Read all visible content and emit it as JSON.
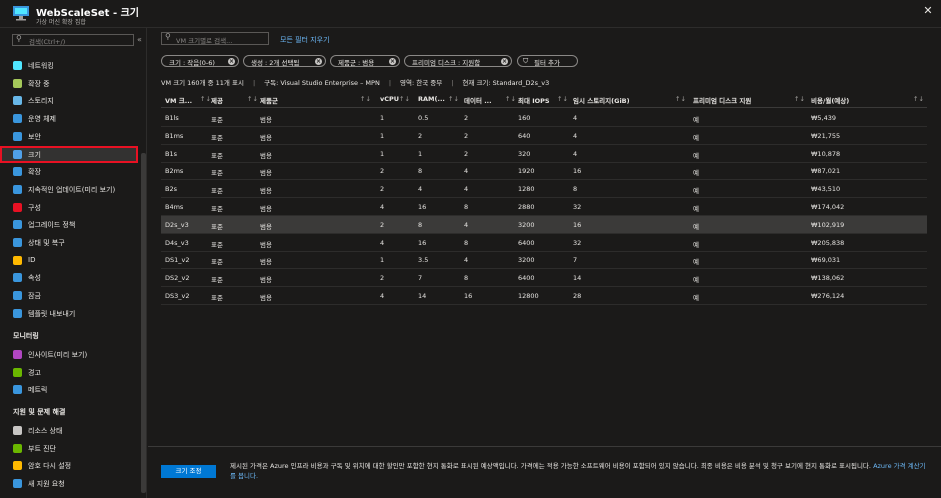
{
  "window": {
    "title": "WebScaleSet - 크기",
    "subtitle": "가상 머신 확장 집합",
    "close_glyph": "✕"
  },
  "sidebar": {
    "search_placeholder": "검색(Ctrl+/)",
    "collapse_glyph": "«",
    "items": [
      {
        "label": "네트워킹",
        "icon": "networking-icon",
        "color": "#50e6ff"
      },
      {
        "label": "확장 중",
        "icon": "scaling-icon",
        "color": "#a5c85a"
      },
      {
        "label": "스토리지",
        "icon": "storage-icon",
        "color": "#68b7e8"
      },
      {
        "label": "운영 체제",
        "icon": "os-icon",
        "color": "#3a96dd"
      },
      {
        "label": "보안",
        "icon": "shield-icon",
        "color": "#3a96dd"
      },
      {
        "label": "크기",
        "icon": "size-icon",
        "color": "#50a0e8"
      },
      {
        "label": "확장",
        "icon": "extensions-icon",
        "color": "#3a96dd"
      },
      {
        "label": "지속적인 업데이트(미리 보기)",
        "icon": "update-icon",
        "color": "#3a96dd"
      },
      {
        "label": "구성",
        "icon": "configuration-icon",
        "color": "#e81123"
      },
      {
        "label": "업그레이드 정책",
        "icon": "upgrade-policy-icon",
        "color": "#3a96dd"
      },
      {
        "label": "상태 및 복구",
        "icon": "health-icon",
        "color": "#3a96dd"
      },
      {
        "label": "ID",
        "icon": "identity-icon",
        "color": "#ffb900"
      },
      {
        "label": "속성",
        "icon": "properties-icon",
        "color": "#3a96dd"
      },
      {
        "label": "잠금",
        "icon": "lock-icon",
        "color": "#3a96dd"
      },
      {
        "label": "템플릿 내보내기",
        "icon": "export-template-icon",
        "color": "#3a96dd"
      }
    ],
    "monitoring_heading": "모니터링",
    "monitoring_items": [
      {
        "label": "인사이트(미리 보기)",
        "icon": "insights-icon",
        "color": "#b146c2"
      },
      {
        "label": "경고",
        "icon": "alerts-icon",
        "color": "#6bb700"
      },
      {
        "label": "메트릭",
        "icon": "metrics-icon",
        "color": "#3a96dd"
      }
    ],
    "support_heading": "지원 및 문제 해결",
    "support_items": [
      {
        "label": "리소스 상태",
        "icon": "resource-health-icon",
        "color": "#c8c6c4"
      },
      {
        "label": "부트 진단",
        "icon": "boot-diagnostics-icon",
        "color": "#6bb700"
      },
      {
        "label": "암호 다시 설정",
        "icon": "reset-password-icon",
        "color": "#ffb900"
      },
      {
        "label": "새 지원 요청",
        "icon": "support-request-icon",
        "color": "#3a96dd"
      }
    ]
  },
  "main": {
    "search_placeholder": "VM 크기별로 검색...",
    "clear_filters": "모든 필터 지우기",
    "filters": [
      {
        "text": "크기 : 작음(0-6)"
      },
      {
        "text": "생성 : 2개 선택됨"
      },
      {
        "text": "제품군 : 범용"
      },
      {
        "text": "프리미엄 디스크 : 지원함"
      }
    ],
    "add_filter": "필터 추가",
    "info": {
      "count": "VM 크기 160개 중 11개 표시",
      "subscription": "구독: Visual Studio Enterprise – MPN",
      "region": "영역: 한국 중부",
      "current": "현재 크기: Standard_D2s_v3"
    },
    "columns": [
      "VM 크...",
      "제공",
      "제품군",
      "vCPU",
      "RAM(...",
      "데이터 ...",
      "최대 IOPS",
      "임시 스토리지(GiB)",
      "프리미엄 디스크 지원",
      "비용/월(예상)"
    ],
    "rows": [
      [
        "B1ls",
        "표준",
        "범용",
        "1",
        "0.5",
        "2",
        "160",
        "4",
        "예",
        "₩5,439"
      ],
      [
        "B1ms",
        "표준",
        "범용",
        "1",
        "2",
        "2",
        "640",
        "4",
        "예",
        "₩21,755"
      ],
      [
        "B1s",
        "표준",
        "범용",
        "1",
        "1",
        "2",
        "320",
        "4",
        "예",
        "₩10,878"
      ],
      [
        "B2ms",
        "표준",
        "범용",
        "2",
        "8",
        "4",
        "1920",
        "16",
        "예",
        "₩87,021"
      ],
      [
        "B2s",
        "표준",
        "범용",
        "2",
        "4",
        "4",
        "1280",
        "8",
        "예",
        "₩43,510"
      ],
      [
        "B4ms",
        "표준",
        "범용",
        "4",
        "16",
        "8",
        "2880",
        "32",
        "예",
        "₩174,042"
      ],
      [
        "D2s_v3",
        "표준",
        "범용",
        "2",
        "8",
        "4",
        "3200",
        "16",
        "예",
        "₩102,919"
      ],
      [
        "D4s_v3",
        "표준",
        "범용",
        "4",
        "16",
        "8",
        "6400",
        "32",
        "예",
        "₩205,838"
      ],
      [
        "DS1_v2",
        "표준",
        "범용",
        "1",
        "3.5",
        "4",
        "3200",
        "7",
        "예",
        "₩69,031"
      ],
      [
        "DS2_v2",
        "표준",
        "범용",
        "2",
        "7",
        "8",
        "6400",
        "14",
        "예",
        "₩138,062"
      ],
      [
        "DS3_v2",
        "표준",
        "범용",
        "4",
        "14",
        "16",
        "12800",
        "28",
        "예",
        "₩276,124"
      ]
    ],
    "selected_row": "D2s_v3"
  },
  "footer": {
    "button": "크기 조정",
    "text": "제시된 가격은 Azure 인프라 비용과 구독 및 위치에 대한 할인만 포함한 현지 통화로 표시된 예상액입니다. 가격에는 적용 가능한 소프트웨어 비용이 포함되어 있지 않습니다. 최종 비용은 비용 분석 및 청구 보기에 현지 통화로 표시됩니다. ",
    "link": "Azure 가격 계산기를 봅니다."
  }
}
